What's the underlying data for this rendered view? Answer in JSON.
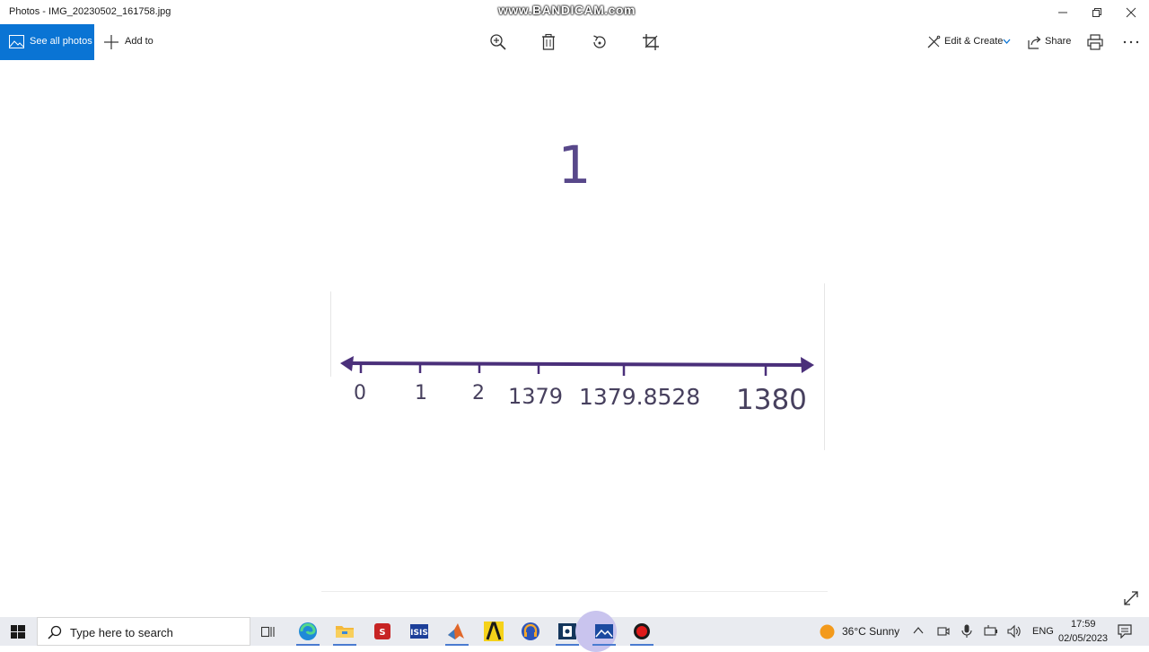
{
  "window": {
    "title": "Photos - IMG_20230502_161758.jpg",
    "watermark": "www.BANDICAM.com"
  },
  "toolbar": {
    "see_all_photos": "See all photos",
    "add_to": "Add to",
    "edit_create": "Edit & Create",
    "share": "Share",
    "icons": [
      "zoom-icon",
      "delete-icon",
      "rotate-icon",
      "crop-icon",
      "print-icon",
      "more-icon"
    ]
  },
  "photo": {
    "heading": "1",
    "number_line_labels": [
      "0",
      "1",
      "2",
      "1379",
      "1379.8528",
      "1380"
    ]
  },
  "taskbar": {
    "search_placeholder": "Type here to search",
    "weather": "36°C  Sunny",
    "language": "ENG",
    "time": "17:59",
    "date": "02/05/2023"
  },
  "colors": {
    "accent": "#0a74d4",
    "line": "#4a2f7a",
    "digit": "#58488a"
  }
}
